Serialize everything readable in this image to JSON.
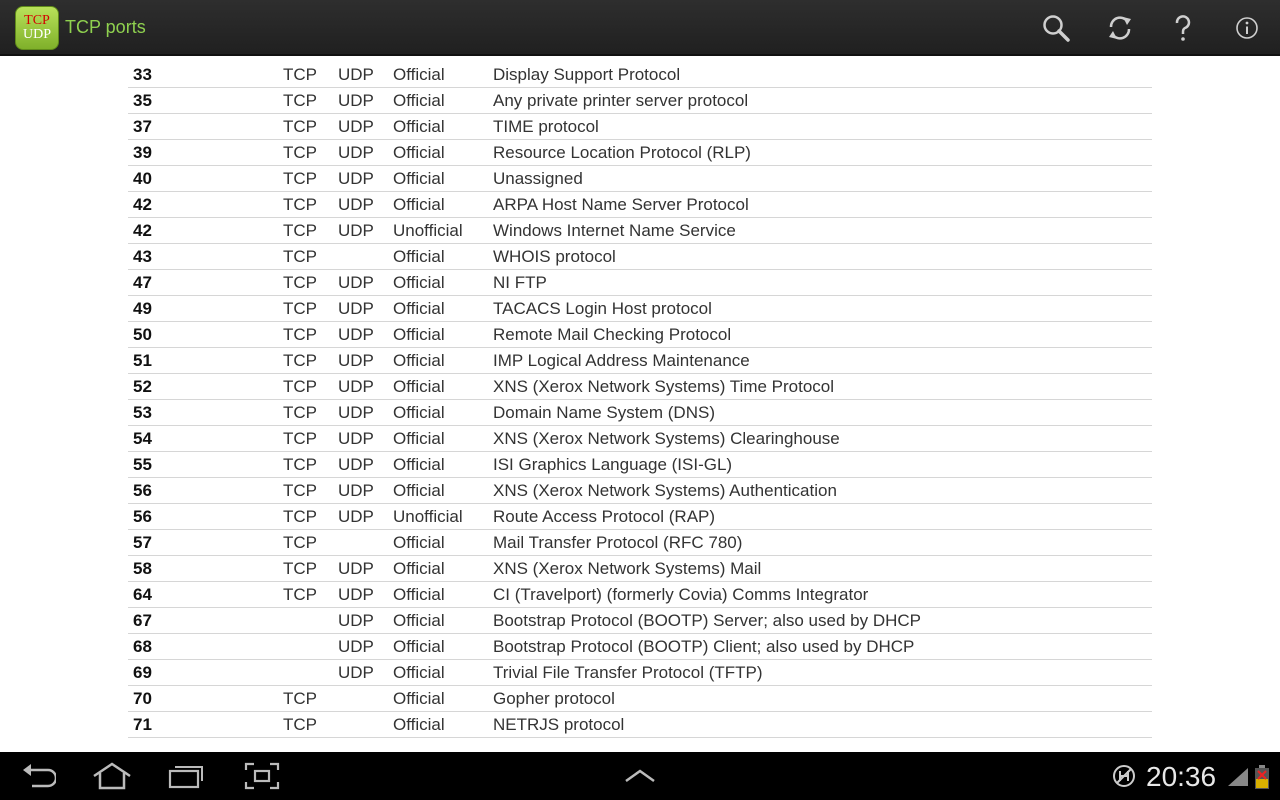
{
  "app": {
    "icon_line1": "TCP",
    "icon_line2": "UDP",
    "title": "TCP ports"
  },
  "toolbar": {
    "icons": [
      "search-icon",
      "refresh-icon",
      "help-icon",
      "info-icon"
    ]
  },
  "colors": {
    "actionbar_bg": "#272727",
    "title_green": "#8fd14f",
    "row_divider": "#d6d6d6",
    "content_bg": "#ffffff"
  },
  "ports": [
    {
      "port": "33",
      "tcp": "TCP",
      "udp": "UDP",
      "status": "Official",
      "desc": "Display Support Protocol"
    },
    {
      "port": "35",
      "tcp": "TCP",
      "udp": "UDP",
      "status": "Official",
      "desc": "Any private printer server protocol"
    },
    {
      "port": "37",
      "tcp": "TCP",
      "udp": "UDP",
      "status": "Official",
      "desc": "TIME protocol"
    },
    {
      "port": "39",
      "tcp": "TCP",
      "udp": "UDP",
      "status": "Official",
      "desc": "Resource Location Protocol (RLP)"
    },
    {
      "port": "40",
      "tcp": "TCP",
      "udp": "UDP",
      "status": "Official",
      "desc": "Unassigned"
    },
    {
      "port": "42",
      "tcp": "TCP",
      "udp": "UDP",
      "status": "Official",
      "desc": "ARPA Host Name Server Protocol"
    },
    {
      "port": "42",
      "tcp": "TCP",
      "udp": "UDP",
      "status": "Unofficial",
      "desc": "Windows Internet Name Service"
    },
    {
      "port": "43",
      "tcp": "TCP",
      "udp": "",
      "status": "Official",
      "desc": "WHOIS protocol"
    },
    {
      "port": "47",
      "tcp": "TCP",
      "udp": "UDP",
      "status": "Official",
      "desc": "NI FTP"
    },
    {
      "port": "49",
      "tcp": "TCP",
      "udp": "UDP",
      "status": "Official",
      "desc": "TACACS Login Host protocol"
    },
    {
      "port": "50",
      "tcp": "TCP",
      "udp": "UDP",
      "status": "Official",
      "desc": "Remote Mail Checking Protocol"
    },
    {
      "port": "51",
      "tcp": "TCP",
      "udp": "UDP",
      "status": "Official",
      "desc": "IMP Logical Address Maintenance"
    },
    {
      "port": "52",
      "tcp": "TCP",
      "udp": "UDP",
      "status": "Official",
      "desc": "XNS (Xerox Network Systems) Time Protocol"
    },
    {
      "port": "53",
      "tcp": "TCP",
      "udp": "UDP",
      "status": "Official",
      "desc": "Domain Name System (DNS)"
    },
    {
      "port": "54",
      "tcp": "TCP",
      "udp": "UDP",
      "status": "Official",
      "desc": "XNS (Xerox Network Systems) Clearinghouse"
    },
    {
      "port": "55",
      "tcp": "TCP",
      "udp": "UDP",
      "status": "Official",
      "desc": "ISI Graphics Language (ISI-GL)"
    },
    {
      "port": "56",
      "tcp": "TCP",
      "udp": "UDP",
      "status": "Official",
      "desc": "XNS (Xerox Network Systems) Authentication"
    },
    {
      "port": "56",
      "tcp": "TCP",
      "udp": "UDP",
      "status": "Unofficial",
      "desc": "Route Access Protocol (RAP)"
    },
    {
      "port": "57",
      "tcp": "TCP",
      "udp": "",
      "status": "Official",
      "desc": "Mail Transfer Protocol (RFC 780)"
    },
    {
      "port": "58",
      "tcp": "TCP",
      "udp": "UDP",
      "status": "Official",
      "desc": "XNS (Xerox Network Systems) Mail"
    },
    {
      "port": "64",
      "tcp": "TCP",
      "udp": "UDP",
      "status": "Official",
      "desc": "CI (Travelport) (formerly Covia) Comms Integrator"
    },
    {
      "port": "67",
      "tcp": "",
      "udp": "UDP",
      "status": "Official",
      "desc": "Bootstrap Protocol (BOOTP) Server; also used by DHCP"
    },
    {
      "port": "68",
      "tcp": "",
      "udp": "UDP",
      "status": "Official",
      "desc": "Bootstrap Protocol (BOOTP) Client; also used by DHCP"
    },
    {
      "port": "69",
      "tcp": "",
      "udp": "UDP",
      "status": "Official",
      "desc": "Trivial File Transfer Protocol (TFTP)"
    },
    {
      "port": "70",
      "tcp": "TCP",
      "udp": "",
      "status": "Official",
      "desc": "Gopher protocol"
    },
    {
      "port": "71",
      "tcp": "TCP",
      "udp": "",
      "status": "Official",
      "desc": "NETRJS protocol"
    }
  ],
  "system_bar": {
    "nav_icons": [
      "back-icon",
      "home-icon",
      "recent-apps-icon",
      "screenshot-icon",
      "menu-up-icon"
    ],
    "time": "20:36",
    "status_icons": [
      "sync-icon",
      "signal-icon",
      "battery-icon"
    ]
  }
}
